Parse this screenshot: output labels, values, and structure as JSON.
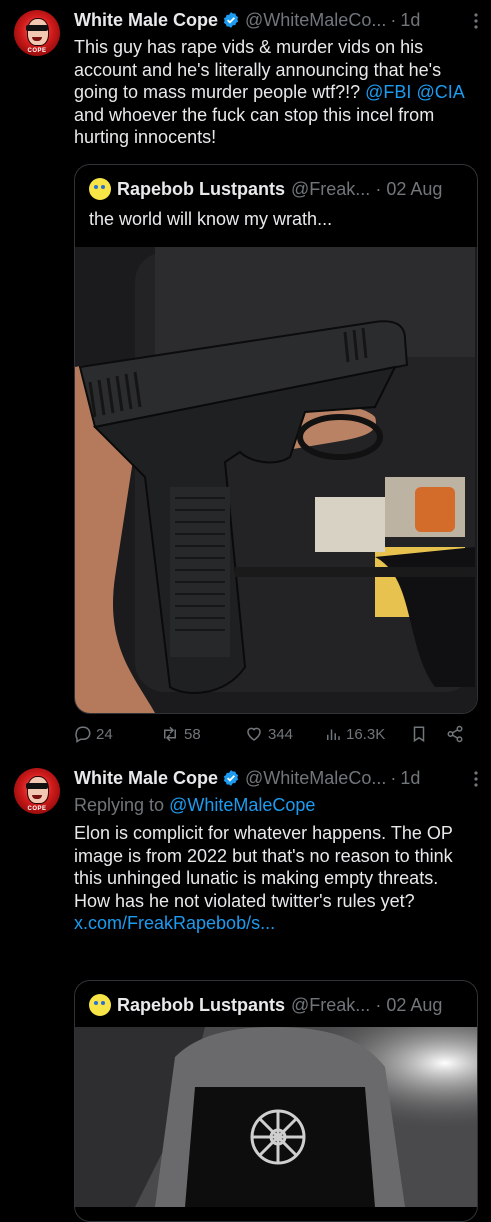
{
  "tweet1": {
    "name": "White Male Cope",
    "handle": "@WhiteMaleCo...",
    "dot": "·",
    "time": "1d",
    "text_a": "This guy has rape vids & murder vids on his account and he's literally announcing that he's going to mass murder people wtf?!? ",
    "mention1": "@FBI",
    "mention2": "@CIA",
    "text_b": " and whoever the fuck can stop this incel from hurting innocents!",
    "quote": {
      "name": "Rapebob Lustpants",
      "handle": "@Freak...",
      "dot": "·",
      "date": "02 Aug",
      "text": "the world will know my wrath..."
    },
    "stats": {
      "replies": "24",
      "reposts": "58",
      "likes": "344",
      "views": "16.3K"
    }
  },
  "tweet2": {
    "name": "White Male Cope",
    "handle": "@WhiteMaleCo...",
    "dot": "·",
    "time": "1d",
    "replying_to_label": "Replying to ",
    "replying_to": "@WhiteMaleCope",
    "text": "Elon is complicit for whatever happens. The OP image is from 2022 but that's no reason to think this unhinged lunatic is making empty threats. How has he not violated twitter's rules yet?",
    "link": "x.com/FreakRapebob/s...",
    "quote": {
      "name": "Rapebob Lustpants",
      "handle": "@Freak...",
      "dot": "·",
      "date": "02 Aug"
    }
  },
  "icons": [
    "more-icon",
    "verified-badge-icon",
    "reply-icon",
    "repost-icon",
    "like-icon",
    "views-icon",
    "bookmark-icon",
    "share-icon"
  ],
  "colors": {
    "background": "#000000",
    "text": "#e7e9ea",
    "secondary": "#71767b",
    "link": "#1d9bf0",
    "verified": "#1d9bf0",
    "border": "#2f3336"
  }
}
